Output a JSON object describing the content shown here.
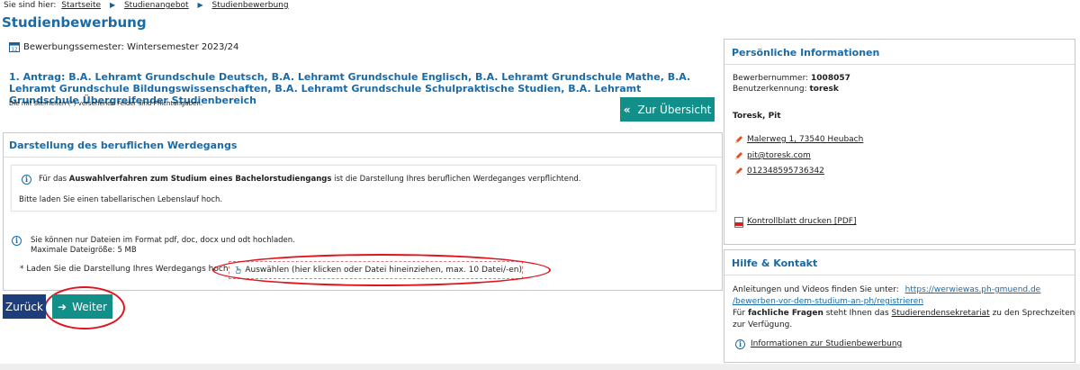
{
  "breadcrumb": {
    "prefix": "Sie sind hier:",
    "items": [
      "Startseite",
      "Studienangebot",
      "Studienbewerbung"
    ]
  },
  "page_title": "Studienbewerbung",
  "semester": "Bewerbungssemester: Wintersemester 2023/24",
  "antrag": "1. Antrag: B.A. Lehramt Grundschule Deutsch, B.A. Lehramt Grundschule Englisch, B.A. Lehramt Grundschule Mathe, B.A. Lehramt Grundschule Bildungswissenschaften, B.A. Lehramt Grundschule Schulpraktische Studien, B.A. Lehramt Grundschule Übergreifender Studienbereich",
  "pflicht_hint": "Die mit Sternchen (*) versehenen Felder sind Pflichtangaben.",
  "overview_button": "Zur Übersicht",
  "main_panel": {
    "heading": "Darstellung des beruflichen Werdegangs",
    "info_line1_pre": "Für das ",
    "info_line1_bold": "Auswahlverfahren zum Studium eines Bachelorstudiengangs",
    "info_line1_post": " ist die Darstellung Ihres beruflichen Werdeganges verpflichtend.",
    "info_line2": "Bitte laden Sie einen tabellarischen Lebenslauf hoch.",
    "upload_info1": "Sie können nur Dateien im Format pdf, doc, docx und odt hochladen.",
    "upload_info2": "Maximale Dateigröße: 5 MB",
    "upload_label": "* Laden Sie die Darstellung Ihres Werdegangs hoch",
    "dropzone_text": "Auswählen (hier klicken oder Datei hineinziehen, max. 10 Datei/-en)"
  },
  "buttons": {
    "back": "Zurück",
    "next": "Weiter"
  },
  "personal": {
    "heading": "Persönliche Informationen",
    "applicant_no_label": "Bewerbernummer:",
    "applicant_no": "1008057",
    "username_label": "Benutzerkennung:",
    "username": "toresk",
    "name": "Toresk, Pit",
    "address": "Malerweg 1, 73540 Heubach",
    "email": "pit@toresk.com",
    "phone": "012348595736342",
    "print_link": "Kontrollblatt drucken [PDF]"
  },
  "help": {
    "heading": "Hilfe & Kontakt",
    "line1": "Anleitungen und Videos finden Sie unter:",
    "url_part1": "https://werwiewas.ph-gmuend.de",
    "url_part2": "/bewerben-vor-dem-studium-an-ph/registrieren",
    "line2_pre": "Für ",
    "line2_bold": "fachliche Fragen",
    "line2_mid": " steht Ihnen das ",
    "line2_link": "Studierendensekretariat",
    "line2_post": " zu den Sprechzeiten",
    "line3": "zur Verfügung.",
    "info_link": "Informationen zur Studienbewerbung"
  },
  "colors": {
    "title_blue": "#1a6aa6",
    "teal_button": "#138f8a",
    "navy_button": "#1d3e7a",
    "annotation_red": "#e0141e"
  }
}
